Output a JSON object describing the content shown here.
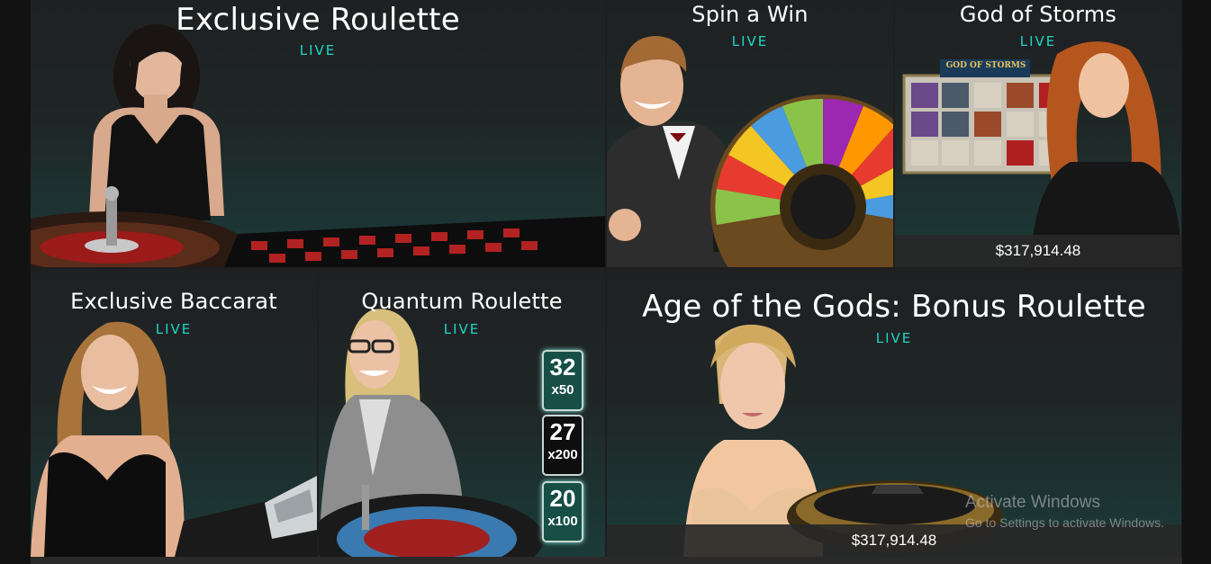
{
  "tiles": [
    {
      "title": "Exclusive Roulette",
      "badge": "LIVE"
    },
    {
      "title": "Spin a Win",
      "badge": "LIVE"
    },
    {
      "title": "God of Storms",
      "badge": "LIVE",
      "jackpot": "$317,914.48",
      "logo_text": "GOD OF STORMS"
    },
    {
      "title": "Exclusive Baccarat",
      "badge": "LIVE"
    },
    {
      "title": "Quantum Roulette",
      "badge": "LIVE",
      "multipliers": [
        {
          "number": "32",
          "mult": "x50"
        },
        {
          "number": "27",
          "mult": "x200"
        },
        {
          "number": "20",
          "mult": "x100"
        }
      ]
    },
    {
      "title": "Age of the Gods: Bonus Roulette",
      "badge": "LIVE",
      "jackpot": "$317,914.48"
    }
  ],
  "watermark": {
    "title": "Activate Windows",
    "subtitle": "Go to Settings to activate Windows."
  },
  "colors": {
    "live": "#1fd4c6",
    "background": "#1e1e1e"
  }
}
